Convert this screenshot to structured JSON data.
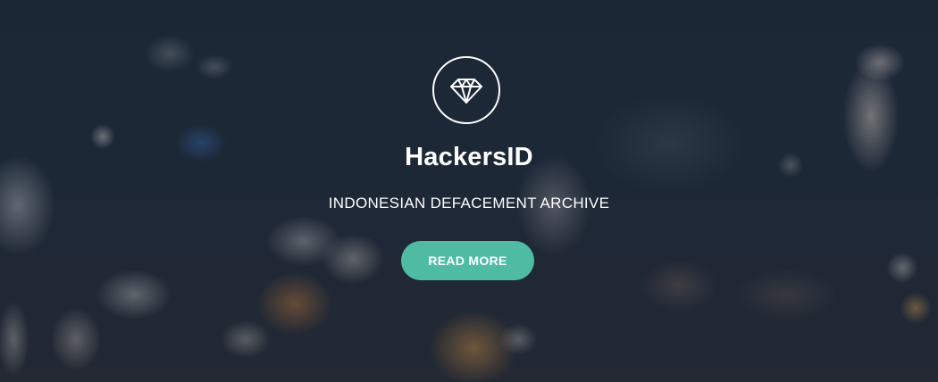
{
  "hero": {
    "icon": "diamond-icon",
    "title": "HackersID",
    "tagline": "INDONESIAN DEFACEMENT ARCHIVE",
    "button_label": "READ MORE"
  },
  "colors": {
    "accent": "#4fbba3",
    "text": "#ffffff",
    "background": "#1f2c3c"
  }
}
